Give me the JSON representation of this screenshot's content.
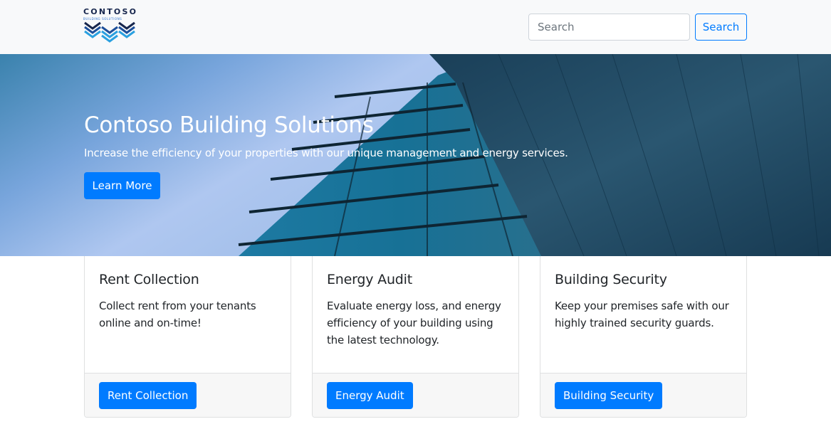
{
  "header": {
    "logo_text": "CONTOSO",
    "logo_tagline": "BUILDING SOLUTIONS",
    "search_placeholder": "Search",
    "search_button": "Search"
  },
  "hero": {
    "title": "Contoso Building Solutions",
    "subtitle": "Increase the efficiency of your properties with our unique management and energy services.",
    "button": "Learn More"
  },
  "cards": [
    {
      "title": "Rent Collection",
      "text": "Collect rent from your tenants online and on-time!",
      "button": "Rent Collection"
    },
    {
      "title": "Energy Audit",
      "text": "Evaluate energy loss, and energy efficiency of your building using the latest technology.",
      "button": "Energy Audit"
    },
    {
      "title": "Building Security",
      "text": "Keep your premises safe with our highly trained security guards.",
      "button": "Building Security"
    }
  ],
  "colors": {
    "primary": "#007bff",
    "navbar_bg": "#f8f9fa",
    "card_footer_bg": "#f7f7f7",
    "logo_dark": "#17264d",
    "logo_light": "#2aa0e0"
  }
}
